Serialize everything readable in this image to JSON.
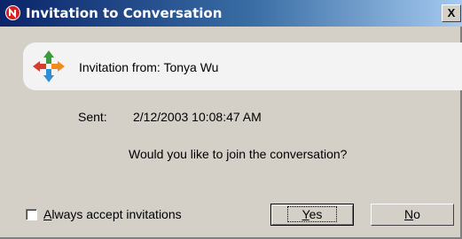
{
  "window": {
    "title": "Invitation to Conversation",
    "close_glyph": "X"
  },
  "header": {
    "from_text": "Invitation from: Tonya Wu",
    "logo_icon": "groupwise-messenger-logo"
  },
  "details": {
    "sent_label": "Sent:",
    "sent_value": "2/12/2003 10:08:47 AM",
    "question": "Would you like to join the conversation?"
  },
  "options": {
    "always_accept": {
      "label_accel": "A",
      "label_rest": "lways accept invitations",
      "checked": false
    }
  },
  "buttons": {
    "yes": {
      "accel": "Y",
      "rest": "es"
    },
    "no": {
      "accel": "N",
      "rest": "o"
    }
  },
  "colors": {
    "titlebar_start": "#0a246a",
    "titlebar_end": "#a6caf0",
    "dialog_bg": "#d4d0c8",
    "panel_bg": "#f3f3f3"
  }
}
